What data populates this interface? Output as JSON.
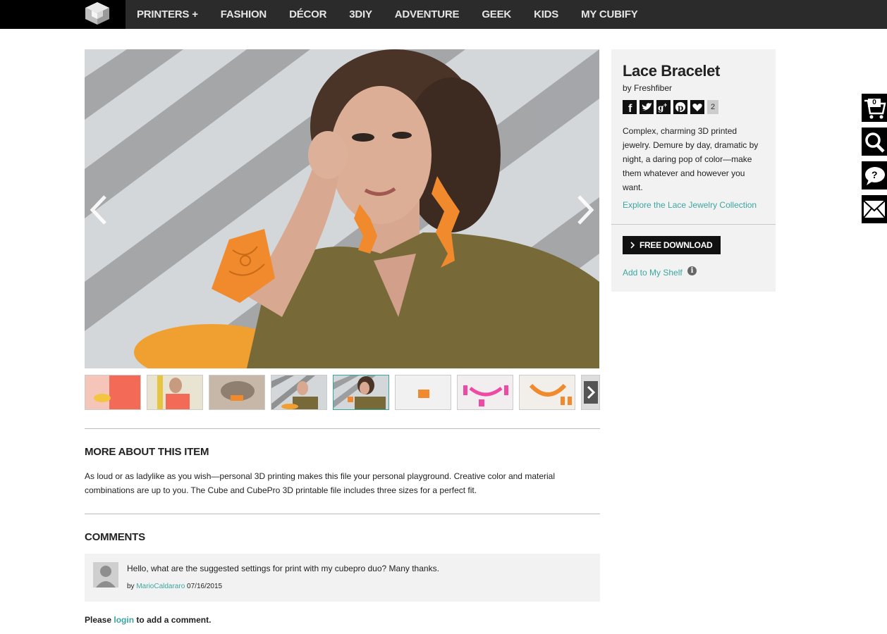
{
  "nav": {
    "logo_icon": "cubify-cube-logo",
    "items": [
      {
        "label": "PRINTERS +"
      },
      {
        "label": "FASHION"
      },
      {
        "label": "DÉCOR"
      },
      {
        "label": "3DIY"
      },
      {
        "label": "ADVENTURE"
      },
      {
        "label": "GEEK"
      },
      {
        "label": "KIDS"
      },
      {
        "label": "MY CUBIFY"
      }
    ]
  },
  "hero": {
    "prev_icon": "chevron-left-icon",
    "next_icon": "chevron-right-icon"
  },
  "thumbnails": {
    "count": 9,
    "active_index": 4,
    "next_icon": "chevron-right-icon"
  },
  "product": {
    "title": "Lace Bracelet",
    "by": "by Freshfiber",
    "social": {
      "icons": [
        "facebook-icon",
        "twitter-icon",
        "google-plus-icon",
        "pinterest-icon",
        "heart-icon"
      ],
      "like_count": "2"
    },
    "description": "Complex, charming 3D printed jewelry. Demure by day, dramatic by night, a daring pop of color—make them whatever and however you want.",
    "explore_link": "Explore the Lace Jewelry Collection",
    "download_label": "FREE DOWNLOAD",
    "shelf_link": "Add to My Shelf"
  },
  "more_about": {
    "title": "MORE ABOUT THIS ITEM",
    "text": "As loud or as ladylike as you wish—personal 3D printing makes this file your personal playground. Creative color and material combinations are up to you. The Cube and CubePro 3D printable file includes three sizes for a perfect fit."
  },
  "comments": {
    "title": "COMMENTS",
    "items": [
      {
        "text": "Hello, what are the suggested settings for print with my cubepro duo? Many thanks.",
        "by_prefix": "by",
        "author": "MarioCaldararo",
        "date": "07/16/2015"
      }
    ],
    "login_prefix": "Please",
    "login_link": "login",
    "login_suffix": "to add a comment."
  },
  "side_tools": {
    "cart_count": "0",
    "icons": [
      "cart-icon",
      "search-icon",
      "help-icon",
      "mail-icon"
    ]
  },
  "colors": {
    "accent": "#3ba6a1",
    "nav_bg": "#2b2b2b",
    "panel_bg": "#f2f2f2",
    "product_orange": "#f08a2c"
  }
}
